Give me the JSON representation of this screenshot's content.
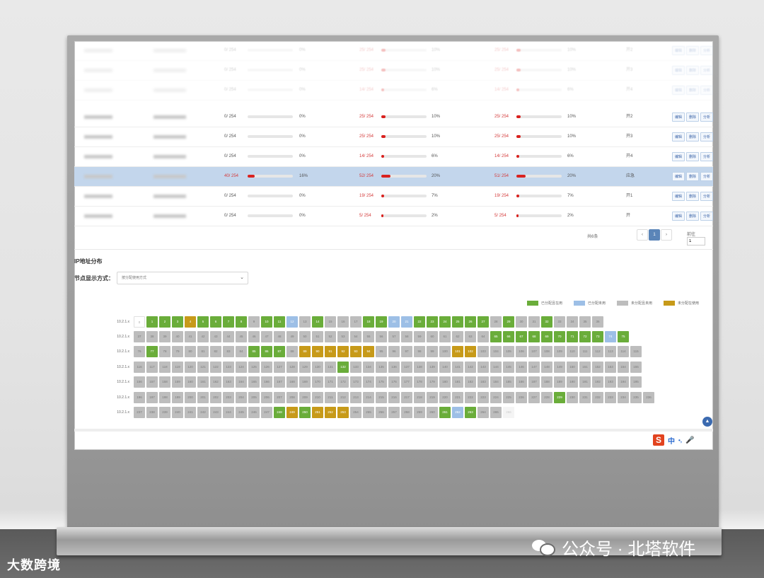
{
  "colors": {
    "allocated_used": "#6aad3a",
    "allocated_unused": "#9dbfe6",
    "unallocated_unused": "#bdbdbd",
    "unallocated_used": "#c79a19",
    "usage_bar": "#d9221f",
    "highlight_row": "#c3d6ec"
  },
  "table": {
    "ghost_rows": [
      {
        "a": "0/ 254",
        "ap": 0,
        "ab": "0%",
        "b": "25/ 254",
        "bp": 10,
        "bb": "10%",
        "c": "25/ 254",
        "cp": 10,
        "cb": "10%",
        "d": "开2",
        "red": false
      },
      {
        "a": "0/ 254",
        "ap": 0,
        "ab": "0%",
        "b": "25/ 254",
        "bp": 10,
        "bb": "10%",
        "c": "25/ 254",
        "cp": 10,
        "cb": "10%",
        "d": "开3",
        "red": false
      },
      {
        "a": "0/ 254",
        "ap": 0,
        "ab": "0%",
        "b": "14/ 254",
        "bp": 6,
        "bb": "6%",
        "c": "14/ 254",
        "cp": 6,
        "cb": "6%",
        "d": "开4",
        "red": false
      }
    ],
    "rows": [
      {
        "a": "0/ 254",
        "ap": 0,
        "ab": "0%",
        "b": "25/ 254",
        "bp": 10,
        "bb": "10%",
        "c": "25/ 254",
        "cp": 10,
        "cb": "10%",
        "d": "开2",
        "hl": false,
        "ared": false
      },
      {
        "a": "0/ 254",
        "ap": 0,
        "ab": "0%",
        "b": "25/ 254",
        "bp": 10,
        "bb": "10%",
        "c": "25/ 254",
        "cp": 10,
        "cb": "10%",
        "d": "开3",
        "hl": false,
        "ared": false
      },
      {
        "a": "0/ 254",
        "ap": 0,
        "ab": "0%",
        "b": "14/ 254",
        "bp": 6,
        "bb": "6%",
        "c": "14/ 254",
        "cp": 6,
        "cb": "6%",
        "d": "开4",
        "hl": false,
        "ared": false
      },
      {
        "a": "40/ 254",
        "ap": 16,
        "ab": "16%",
        "b": "52/ 254",
        "bp": 20,
        "bb": "20%",
        "c": "51/ 254",
        "cp": 20,
        "cb": "20%",
        "d": "应急",
        "hl": true,
        "ared": true
      },
      {
        "a": "0/ 254",
        "ap": 0,
        "ab": "0%",
        "b": "19/ 254",
        "bp": 7,
        "bb": "7%",
        "c": "19/ 254",
        "cp": 7,
        "cb": "7%",
        "d": "开1",
        "hl": false,
        "ared": false
      },
      {
        "a": "0/ 254",
        "ap": 0,
        "ab": "0%",
        "b": "5/ 254",
        "bp": 2,
        "bb": "2%",
        "c": "5/ 254",
        "cp": 2,
        "cb": "2%",
        "d": "开",
        "hl": false,
        "ared": false
      }
    ],
    "actions": [
      "编辑",
      "删除",
      "分析"
    ]
  },
  "pager": {
    "total": "共6条",
    "prev": "‹",
    "page": "1",
    "next": "›",
    "goto": "前往",
    "goto_value": "1"
  },
  "ip_section": {
    "title": "IP地址分布",
    "mode_label": "节点显示方式：",
    "mode_value": "按分配使用方式",
    "legend": [
      {
        "label": "已分配且在用",
        "color": "#6aad3a"
      },
      {
        "label": "已分配未用",
        "color": "#9dbfe6"
      },
      {
        "label": "未分配且未用",
        "color": "#bdbdbd"
      },
      {
        "label": "未分配在使用",
        "color": "#c79a19"
      }
    ],
    "row_labels": [
      "10.2.1.x",
      "10.2.1.x",
      "10.2.1.x",
      "10.2.1.x",
      "10.2.1.x",
      "10.2.1.x",
      "10.2.1.x"
    ],
    "status_codes": [
      "EGGGOGGGGwGGBwGwwwGGBBGGGGGGwGwwGwwww",
      "wwwwwwwwwwwwwwwwwwwwwwwwwwwwGGGGGGGGGBG",
      "wGwwwwwwwGGGwOOOOOOwwwwwwOOwwwwwwwwwwwww",
      "wwwwwwwwwwwwwwwwGwwwwwwwwwwwwwwwwwwwwwww",
      "wwwwwwwwwwwwwwwwwwwwwwwwwwwwwwwwwwwwwwww",
      "wwwwwwwwwwwwwwwwwwwwwwwwwwwwwwwwwGwwwwwww",
      "wwwwwwwwwwwGOGOOOwwwwwwwGBGwwF"
    ]
  },
  "watermark": {
    "left": "大数跨境",
    "right": "公众号 · 北塔软件"
  },
  "ime": {
    "s": "S",
    "zh": "中",
    "dot": "•,",
    "mic": "🎤"
  }
}
